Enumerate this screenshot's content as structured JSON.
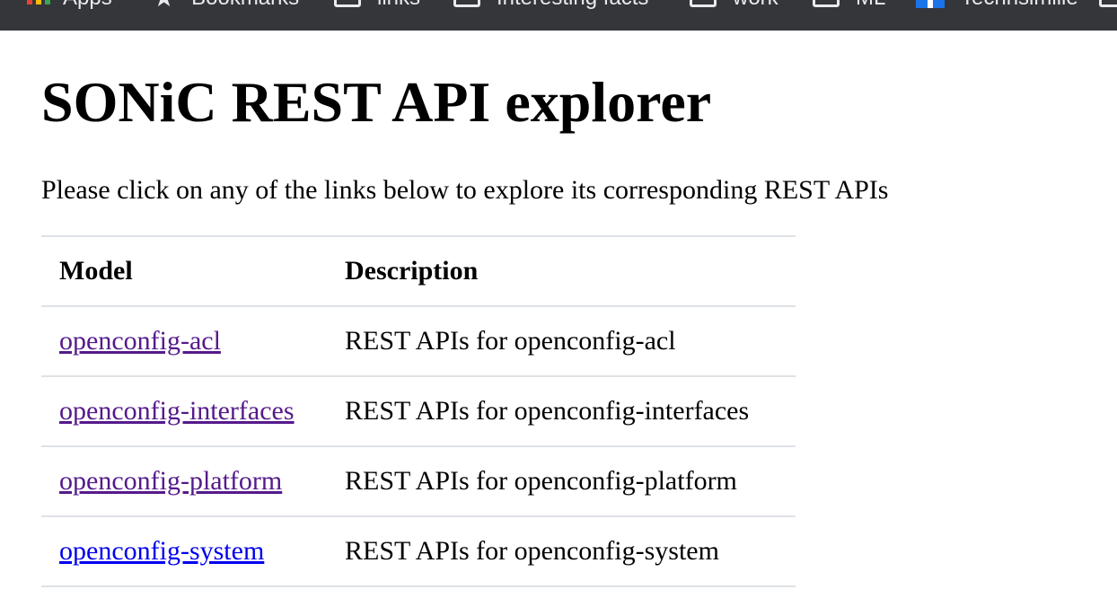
{
  "bookmarks_bar": {
    "items": [
      {
        "label": "Apps",
        "icon": "apps-grid-icon"
      },
      {
        "label": "Bookmarks",
        "icon": "star-icon"
      },
      {
        "label": "links",
        "icon": "folder-icon"
      },
      {
        "label": "Interesting facts",
        "icon": "folder-icon"
      },
      {
        "label": "work",
        "icon": "folder-icon"
      },
      {
        "label": "ML",
        "icon": "folder-icon"
      },
      {
        "label": "Technsimilie",
        "icon": "site-favicon-icon"
      }
    ]
  },
  "page": {
    "title": "SONiC REST API explorer",
    "intro": "Please click on any of the links below to explore its corresponding REST APIs"
  },
  "table": {
    "headers": {
      "model": "Model",
      "description": "Description"
    },
    "rows": [
      {
        "model": "openconfig-acl",
        "description": "REST APIs for openconfig-acl",
        "visited": true
      },
      {
        "model": "openconfig-interfaces",
        "description": "REST APIs for openconfig-interfaces",
        "visited": true
      },
      {
        "model": "openconfig-platform",
        "description": "REST APIs for openconfig-platform",
        "visited": true
      },
      {
        "model": "openconfig-system",
        "description": "REST APIs for openconfig-system",
        "visited": false
      }
    ]
  },
  "colors": {
    "bookmarks_bar_bg": "#35363a",
    "visited_link": "#551a8b",
    "unvisited_link": "#0000ee",
    "table_border": "#dee2e6"
  }
}
